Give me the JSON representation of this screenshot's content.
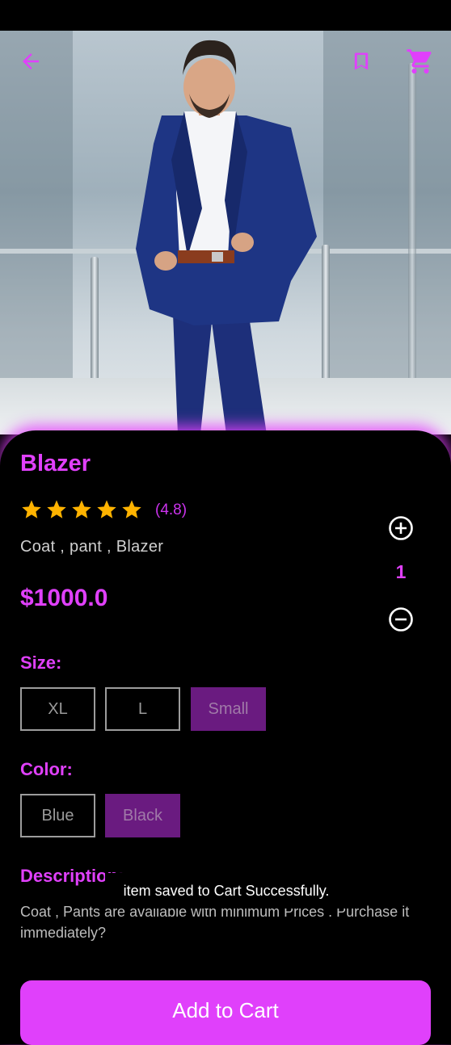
{
  "product": {
    "title": "Blazer",
    "rating": "(4.8)",
    "star_count": 5,
    "subtitle": "Coat ,  pant ,  Blazer",
    "price": "$1000.0",
    "quantity": "1"
  },
  "size": {
    "label": "Size:",
    "options": [
      "XL",
      "L",
      "Small"
    ],
    "selected": "Small"
  },
  "color": {
    "label": "Color:",
    "options": [
      "Blue",
      "Black"
    ],
    "selected": "Black"
  },
  "description": {
    "label": "Description:",
    "text": "Coat , Pants are available with minimum Prices . Purchase it immediately?"
  },
  "toast": {
    "message": "item saved to Cart Successfully."
  },
  "cart_button": {
    "label": "Add to Cart"
  },
  "icons": {
    "back": "arrow-left-icon",
    "bookmark": "bookmark-icon",
    "cart": "shopping-cart-icon",
    "star": "star-icon",
    "plus": "plus-circle-icon",
    "minus": "minus-circle-icon"
  },
  "colors": {
    "accent": "#e040fb",
    "selected_option": "#6a1b80",
    "star": "#ffb300"
  }
}
